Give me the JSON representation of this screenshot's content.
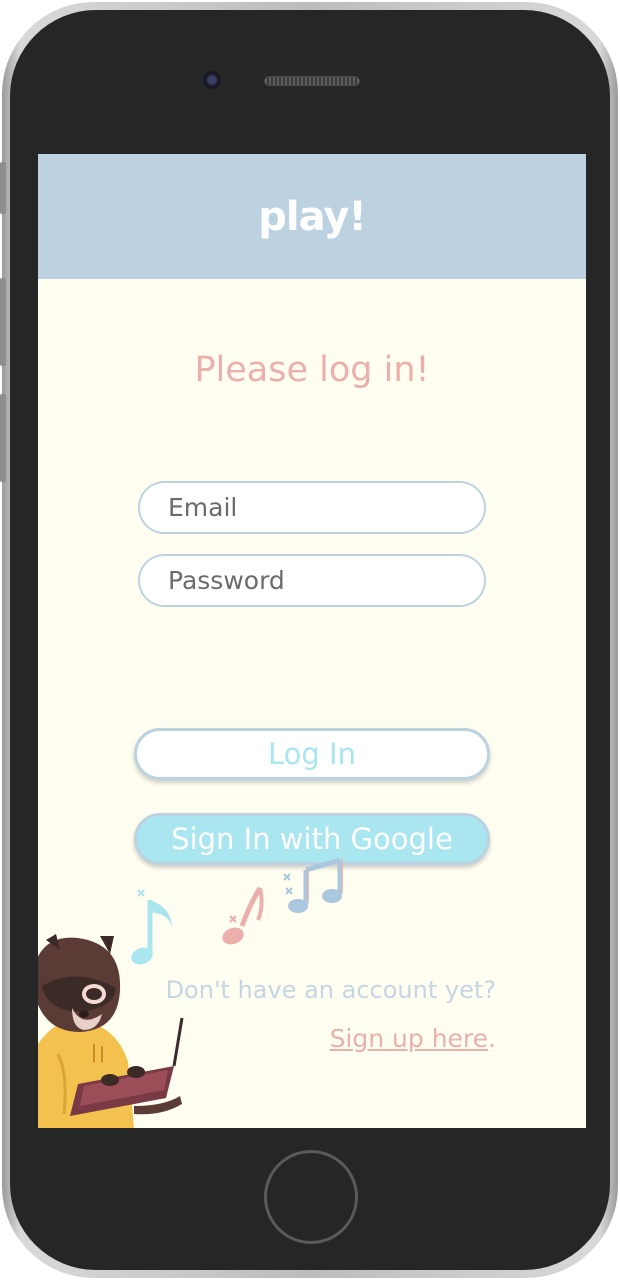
{
  "app": {
    "title": "play!"
  },
  "login": {
    "heading": "Please log in!",
    "email_placeholder": "Email",
    "password_placeholder": "Password",
    "login_label": "Log In",
    "google_label": "Sign In with Google"
  },
  "footer": {
    "no_account_text": "Don't have an account yet?",
    "signup_link": "Sign up here",
    "signup_suffix": "."
  },
  "colors": {
    "header_bg": "#bcd2e0",
    "screen_bg": "#fffef1",
    "accent_pink": "#ebb0ab",
    "accent_cyan": "#a9e6ef"
  },
  "icons": [
    "music-note-icon",
    "raccoon-illustration"
  ]
}
